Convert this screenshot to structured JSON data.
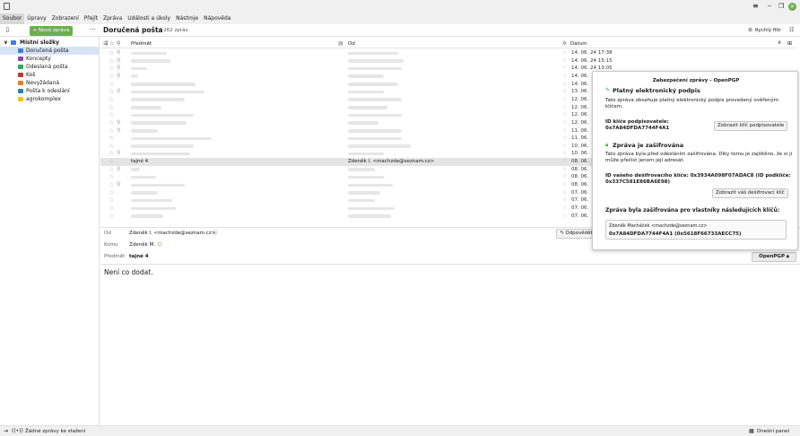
{
  "window": {
    "title_icon": "app-icon",
    "controls": [
      "≡",
      "–",
      "❐",
      "✕"
    ]
  },
  "menubar": {
    "items": [
      "Soubor",
      "Úpravy",
      "Zobrazení",
      "Přejít",
      "Zpráva",
      "Události a úkoly",
      "Nástroje",
      "Nápověda"
    ]
  },
  "toolbar": {
    "new_message": "+ Nová zpráva",
    "more": "···",
    "folder_title": "Doručená pošta",
    "count": "4 262 zpráv",
    "quick_filter": "Rychlý filtr"
  },
  "sidebar": {
    "root": "Místní složky",
    "folders": [
      {
        "label": "Doručená pošta",
        "color": "#3d7fd6"
      },
      {
        "label": "Koncepty",
        "color": "#8e44ad"
      },
      {
        "label": "Odeslaná pošta",
        "color": "#27ae60"
      },
      {
        "label": "Koš",
        "color": "#c0392b"
      },
      {
        "label": "Nevyžádaná",
        "color": "#e67e22"
      },
      {
        "label": "Pošta k odeslání",
        "color": "#2980b9"
      },
      {
        "label": "agrokomplex",
        "color": "#f1c40f"
      }
    ]
  },
  "list": {
    "columns": {
      "subject": "Předmět",
      "from": "Od",
      "date": "Datum"
    },
    "dates": [
      "14. 06. 24 17:38",
      "14. 06. 24 15:15",
      "14. 06. 24 13:05",
      "14. 06.",
      "14. 06.",
      "13. 06.",
      "12. 06.",
      "12. 06.",
      "12. 06.",
      "12. 06.",
      "11. 06.",
      "11. 06.",
      "10. 06.",
      "10. 06.",
      "08. 06.",
      "08. 06.",
      "08. 06.",
      "08. 06.",
      "07. 06.",
      "07. 06.",
      "07. 06.",
      "07. 06."
    ],
    "selected": {
      "subject": "tajné 4",
      "from": "Zdeněk l. <machzde@seznam.cz>",
      "date": "08. 06."
    }
  },
  "message": {
    "from_label": "Od",
    "from_value": "Zdeněk l. <machzde@seznam.cz>",
    "to_label": "Komu",
    "to_value": "Zdeněk M.",
    "subject_label": "Předmět",
    "subject_value": "tajné 4",
    "reply": "Odpovědět",
    "openpgp": "OpenPGP",
    "body": "Není co dodat."
  },
  "popup": {
    "title": "Zabezpečení zprávy - OpenPGP",
    "sig_heading": "Platný elektronický podpis",
    "sig_text": "Tato zpráva obsahuje platný elektronický podpis provedený ověřeným klíčem.",
    "signer_label": "ID klíče podpisovatele:",
    "signer_id": "0x7A84DFDA7744F4A1",
    "show_signer_key": "Zobrazit klíč podpisovatele",
    "enc_heading": "Zpráva je zašifrována",
    "enc_text": "Tato zpráva byla před odesláním zašifrována. Díky tomu je zajištěno, že si ji může přečíst jenom její adresát.",
    "decrypt_label": "ID vašeho dešifrovacího klíče: 0x3934A098F07ADAC8 (ID podklíče: 0x337C581E86BA6E98)",
    "show_decrypt_key": "Zobrazit váš dešifrovací klíč",
    "recipients_heading": "Zpráva byla zašifrována pro vlastníky následujících klíčů:",
    "recipient_name": "Zdeněk Macháček <machzde@seznam.cz>",
    "recipient_key": "0x7A84DFDA7744F4A1 (0x5618F66733AECC75)"
  },
  "status": {
    "text": "Žádné zprávy ke stažení",
    "today_pane": "Dnešní panel"
  }
}
